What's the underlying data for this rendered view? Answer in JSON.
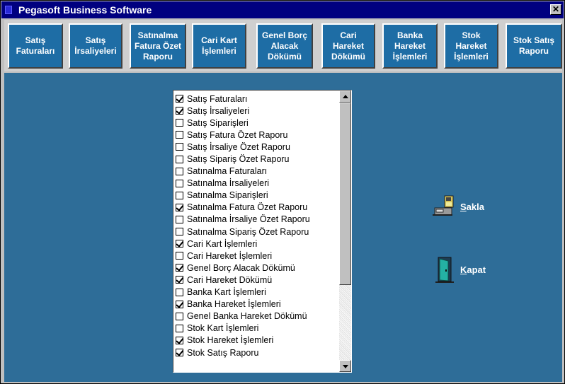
{
  "window": {
    "title": "Pegasoft Business Software",
    "close_label": "✕"
  },
  "toolbar": {
    "buttons": [
      {
        "label": "Satış\nFaturaları"
      },
      {
        "label": "Satış\nİrsaliyeleri"
      },
      {
        "label": "Satınalma\nFatura Özet\nRaporu"
      },
      {
        "label": "Cari Kart\nİşlemleri"
      },
      {
        "label": "Genel Borç\nAlacak\nDökümü"
      },
      {
        "label": "Cari\nHareket\nDökümü"
      },
      {
        "label": "Banka\nHareket\nİşlemleri"
      },
      {
        "label": "Stok\nHareket\nİşlemleri"
      },
      {
        "label": "Stok Satış\nRaporu"
      }
    ]
  },
  "report_list": {
    "items": [
      {
        "label": "Satış  Faturaları",
        "checked": true
      },
      {
        "label": "Satış  İrsaliyeleri",
        "checked": true
      },
      {
        "label": "Satış Siparişleri",
        "checked": false
      },
      {
        "label": "Satış Fatura Özet Raporu",
        "checked": false
      },
      {
        "label": "Satış İrsaliye Özet Raporu",
        "checked": false
      },
      {
        "label": "Satış Sipariş Özet Raporu",
        "checked": false
      },
      {
        "label": "Satınalma Faturaları",
        "checked": false
      },
      {
        "label": "Satınalma İrsaliyeleri",
        "checked": false
      },
      {
        "label": "Satınalma  Siparişleri",
        "checked": false
      },
      {
        "label": "Satınalma Fatura Özet Raporu",
        "checked": true
      },
      {
        "label": "Satınalma İrsaliye Özet Raporu",
        "checked": false
      },
      {
        "label": "Satınalma Sipariş Özet Raporu",
        "checked": false
      },
      {
        "label": "Cari Kart İşlemleri",
        "checked": true
      },
      {
        "label": "Cari Hareket İşlemleri",
        "checked": false
      },
      {
        "label": "Genel Borç Alacak Dökümü",
        "checked": true
      },
      {
        "label": "Cari Hareket Dökümü",
        "checked": true
      },
      {
        "label": "Banka Kart İşlemleri",
        "checked": false
      },
      {
        "label": "Banka Hareket İşlemleri",
        "checked": true
      },
      {
        "label": "Genel Banka Hareket Dökümü",
        "checked": false
      },
      {
        "label": "Stok Kart İşlemleri",
        "checked": false
      },
      {
        "label": "Stok Hareket İşlemleri",
        "checked": true
      },
      {
        "label": "Stok Satış Raporu",
        "checked": true
      }
    ]
  },
  "actions": {
    "save": {
      "first": "S",
      "rest": "akla",
      "icon": "save-disk-icon"
    },
    "close": {
      "first": "K",
      "rest": "apat",
      "icon": "door-exit-icon"
    }
  },
  "colors": {
    "title_bar": "#000080",
    "button_face": "#1e6da5",
    "panel_background": "#2e6d98"
  }
}
